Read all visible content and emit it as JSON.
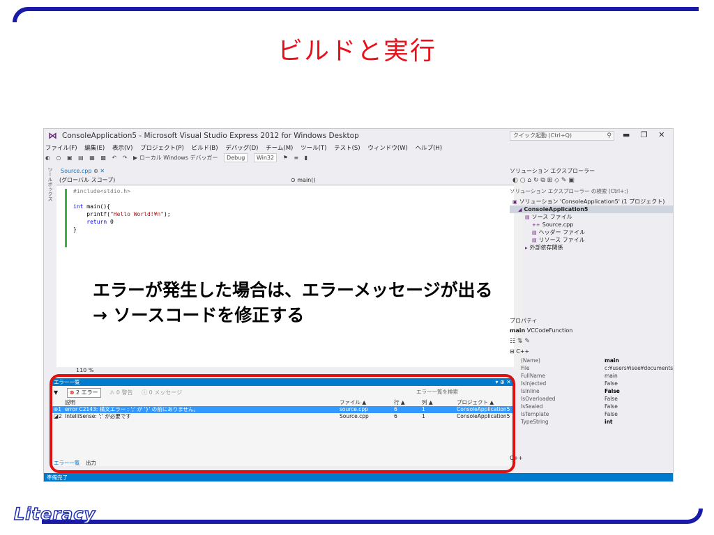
{
  "slide": {
    "title": "ビルドと実行",
    "overlay_line1": "エラーが発生した場合は、エラーメッセージが出る",
    "overlay_line2": "→ ソースコードを修正する",
    "logo": "Literacy",
    "frame_color": "#1a1aa6",
    "title_color": "#e8101a",
    "highlight_color": "#e01010"
  },
  "window": {
    "title": "ConsoleApplication5 - Microsoft Visual Studio Express 2012 for Windows Desktop",
    "quick_launch": "クイック起動 (Ctrl+Q)",
    "icon": "vs-logo-icon"
  },
  "menu": [
    "ファイル(F)",
    "編集(E)",
    "表示(V)",
    "プロジェクト(P)",
    "ビルド(B)",
    "デバッグ(D)",
    "チーム(M)",
    "ツール(T)",
    "テスト(S)",
    "ウィンドウ(W)",
    "ヘルプ(H)"
  ],
  "toolbar": {
    "start_label": "▶ ローカル Windows デバッガー",
    "config": "Debug",
    "platform": "Win32"
  },
  "editor": {
    "tab": "Source.cpp",
    "scope": "(グローバル スコープ)",
    "function": "⊙ main()",
    "side_tabs": "ツールボックス",
    "zoom": "110 %",
    "code": {
      "line1": "#include<stdio.h>",
      "line2_kw": "int",
      "line2_rest": " main(){",
      "line3_fn": "    printf(",
      "line3_str": "\"Hello World!¥n\"",
      "line3_end": ");",
      "line4_kw": "    return",
      "line4_rest": " 0",
      "line5": "}"
    }
  },
  "error_list": {
    "title": "エラー一覧",
    "filter_errors": "2 エラー",
    "filter_warnings": "0 警告",
    "filter_messages": "0 メッセージ",
    "search": "エラー一覧を検索",
    "columns": [
      "説明",
      "ファイル ▲",
      "行 ▲",
      "列 ▲",
      "プロジェクト ▲"
    ],
    "rows": [
      {
        "num": "1",
        "desc": "error C2143: 構文エラー : ';' が '}' の前にありません。",
        "file": "source.cpp",
        "line": "6",
        "col": "1",
        "project": "ConsoleApplication5"
      },
      {
        "num": "2",
        "desc": "IntelliSense: ';' が必要です",
        "file": "Source.cpp",
        "line": "6",
        "col": "1",
        "project": "ConsoleApplication5"
      }
    ],
    "tab_errors": "エラー一覧",
    "tab_output": "出力"
  },
  "solution_explorer": {
    "title": "ソリューション エクスプローラー",
    "search": "ソリューション エクスプローラー の検索 (Ctrl+;)",
    "tree": [
      "ソリューション 'ConsoleApplication5' (1 プロジェクト)",
      "ConsoleApplication5",
      "ソース ファイル",
      "Source.cpp",
      "ヘッダー ファイル",
      "リソース ファイル",
      "外部依存関係"
    ]
  },
  "properties": {
    "title": "プロパティ",
    "object_name": "main",
    "object_type": "VCCodeFunction",
    "category": "C++",
    "rows": [
      {
        "name": "(Name)",
        "value": "main"
      },
      {
        "name": "File",
        "value": "c:¥users¥isee¥documents¥"
      },
      {
        "name": "FullName",
        "value": "main"
      },
      {
        "name": "IsInjected",
        "value": "False"
      },
      {
        "name": "IsInline",
        "value": "False"
      },
      {
        "name": "IsOverloaded",
        "value": "False"
      },
      {
        "name": "IsSealed",
        "value": "False"
      },
      {
        "name": "IsTemplate",
        "value": "False"
      },
      {
        "name": "TypeString",
        "value": "int"
      }
    ],
    "footer": "C++"
  },
  "status": "準備完了"
}
